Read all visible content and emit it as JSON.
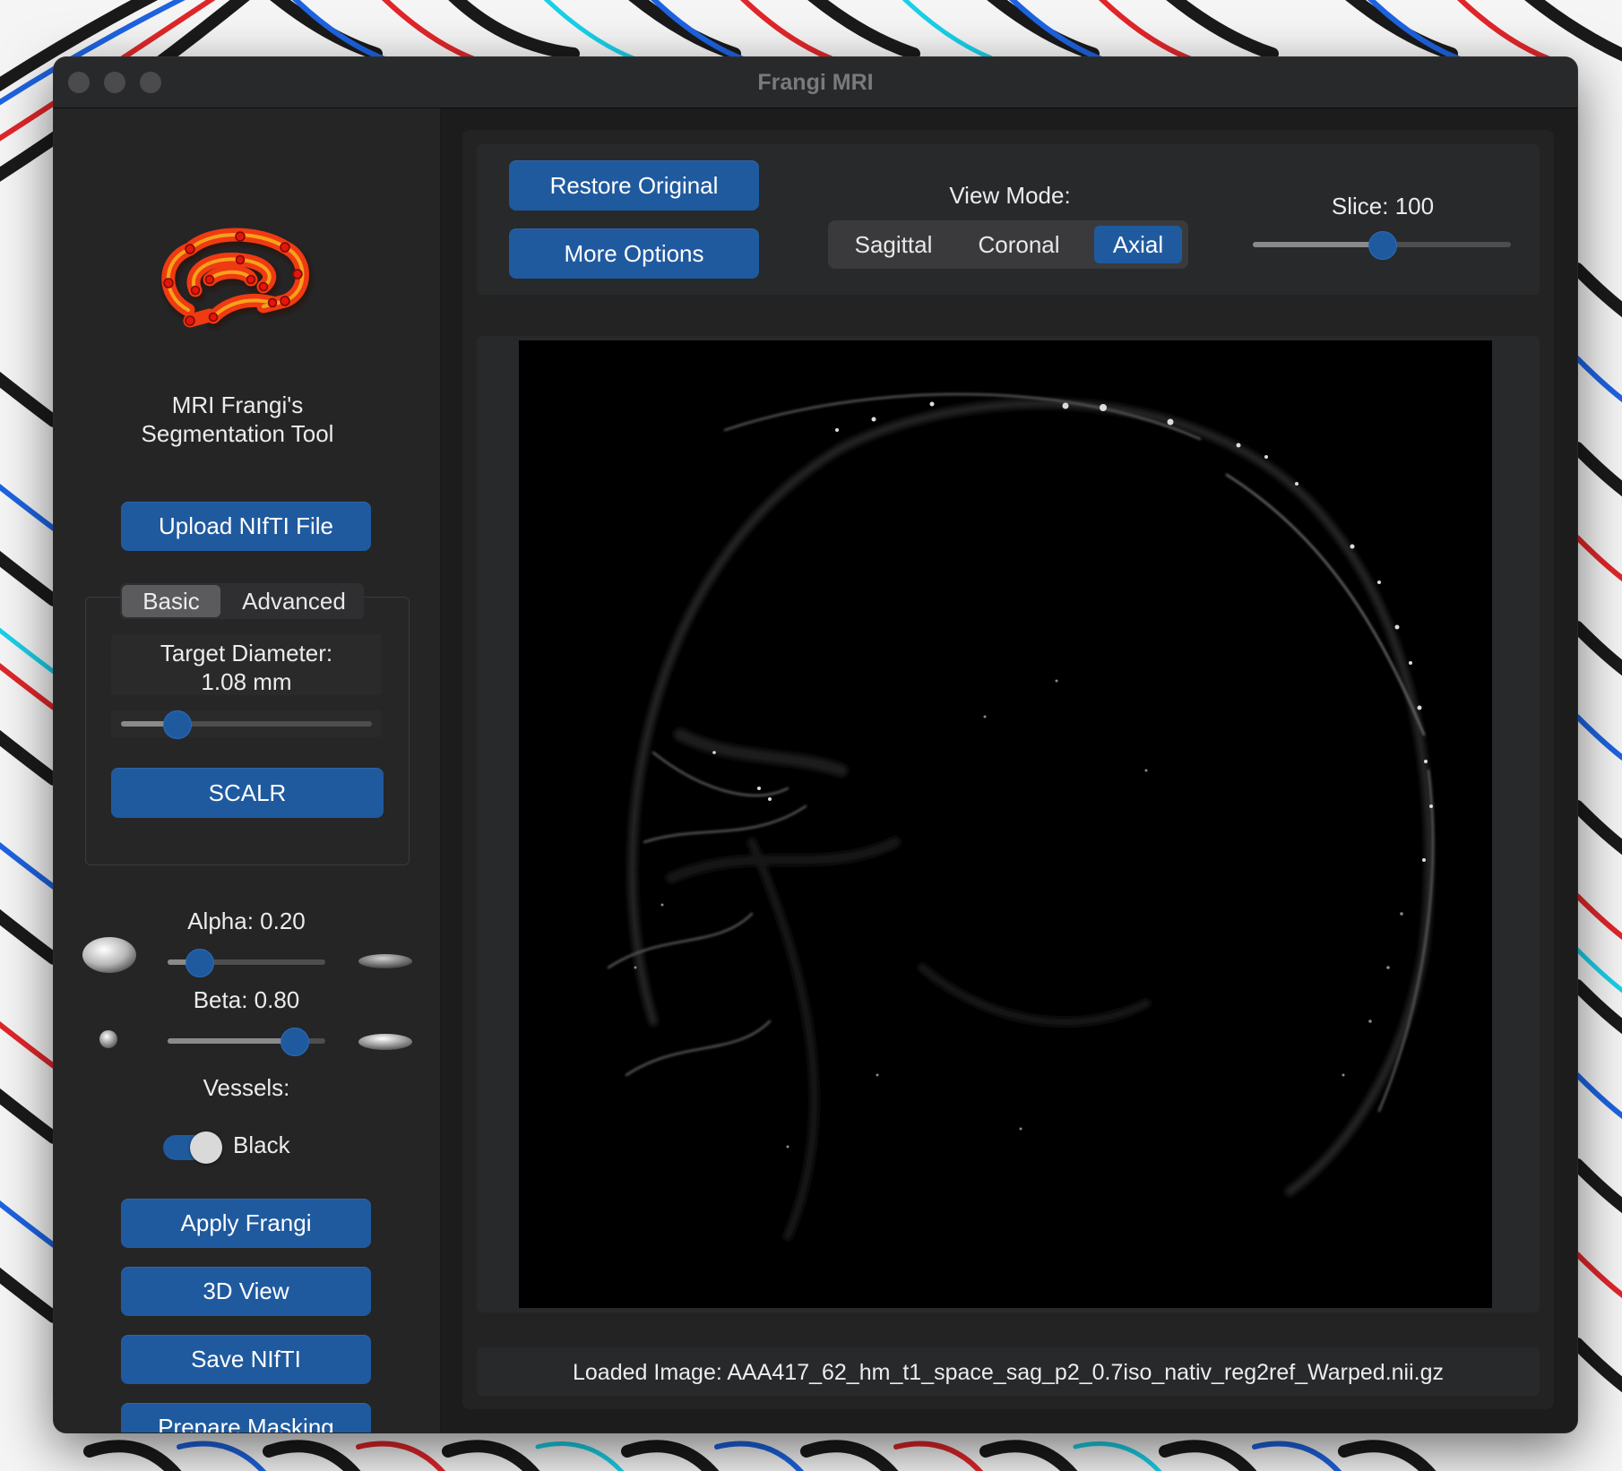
{
  "window": {
    "title": "Frangi MRI"
  },
  "sidebar": {
    "logo_icon": "brain-icon",
    "app_name_line1": "MRI Frangi's",
    "app_name_line2": "Segmentation Tool",
    "upload_label": "Upload NIfTI File",
    "tabs": [
      {
        "label": "Basic",
        "active": true
      },
      {
        "label": "Advanced",
        "active": false
      }
    ],
    "target_diameter_label": "Target Diameter:",
    "target_diameter_value": "1.08 mm",
    "target_diameter_position": 0.22,
    "scalr_label": "SCALR",
    "alpha_label": "Alpha: 0.20",
    "alpha_position": 0.2,
    "beta_label": "Beta: 0.80",
    "beta_position": 0.8,
    "vessels_label": "Vessels:",
    "vessels_toggle_on": true,
    "vessels_value": "Black",
    "apply_label": "Apply Frangi",
    "view3d_label": "3D View",
    "save_label": "Save NIfTI",
    "mask_label": "Prepare Masking"
  },
  "toolbar": {
    "restore_label": "Restore Original",
    "more_label": "More Options",
    "view_mode_label": "View Mode:",
    "view_modes": [
      {
        "label": "Sagittal",
        "active": false
      },
      {
        "label": "Coronal",
        "active": false
      },
      {
        "label": "Axial",
        "active": true
      }
    ],
    "slice_label": "Slice: 100",
    "slice_position": 0.5
  },
  "status": {
    "loaded_image": "Loaded Image: AAA417_62_hm_t1_space_sag_p2_0.7iso_nativ_reg2ref_Warped.nii.gz"
  },
  "colors": {
    "accent": "#1f5a9f",
    "window_bg": "#1c1c1d",
    "sidebar_bg": "#252526"
  }
}
